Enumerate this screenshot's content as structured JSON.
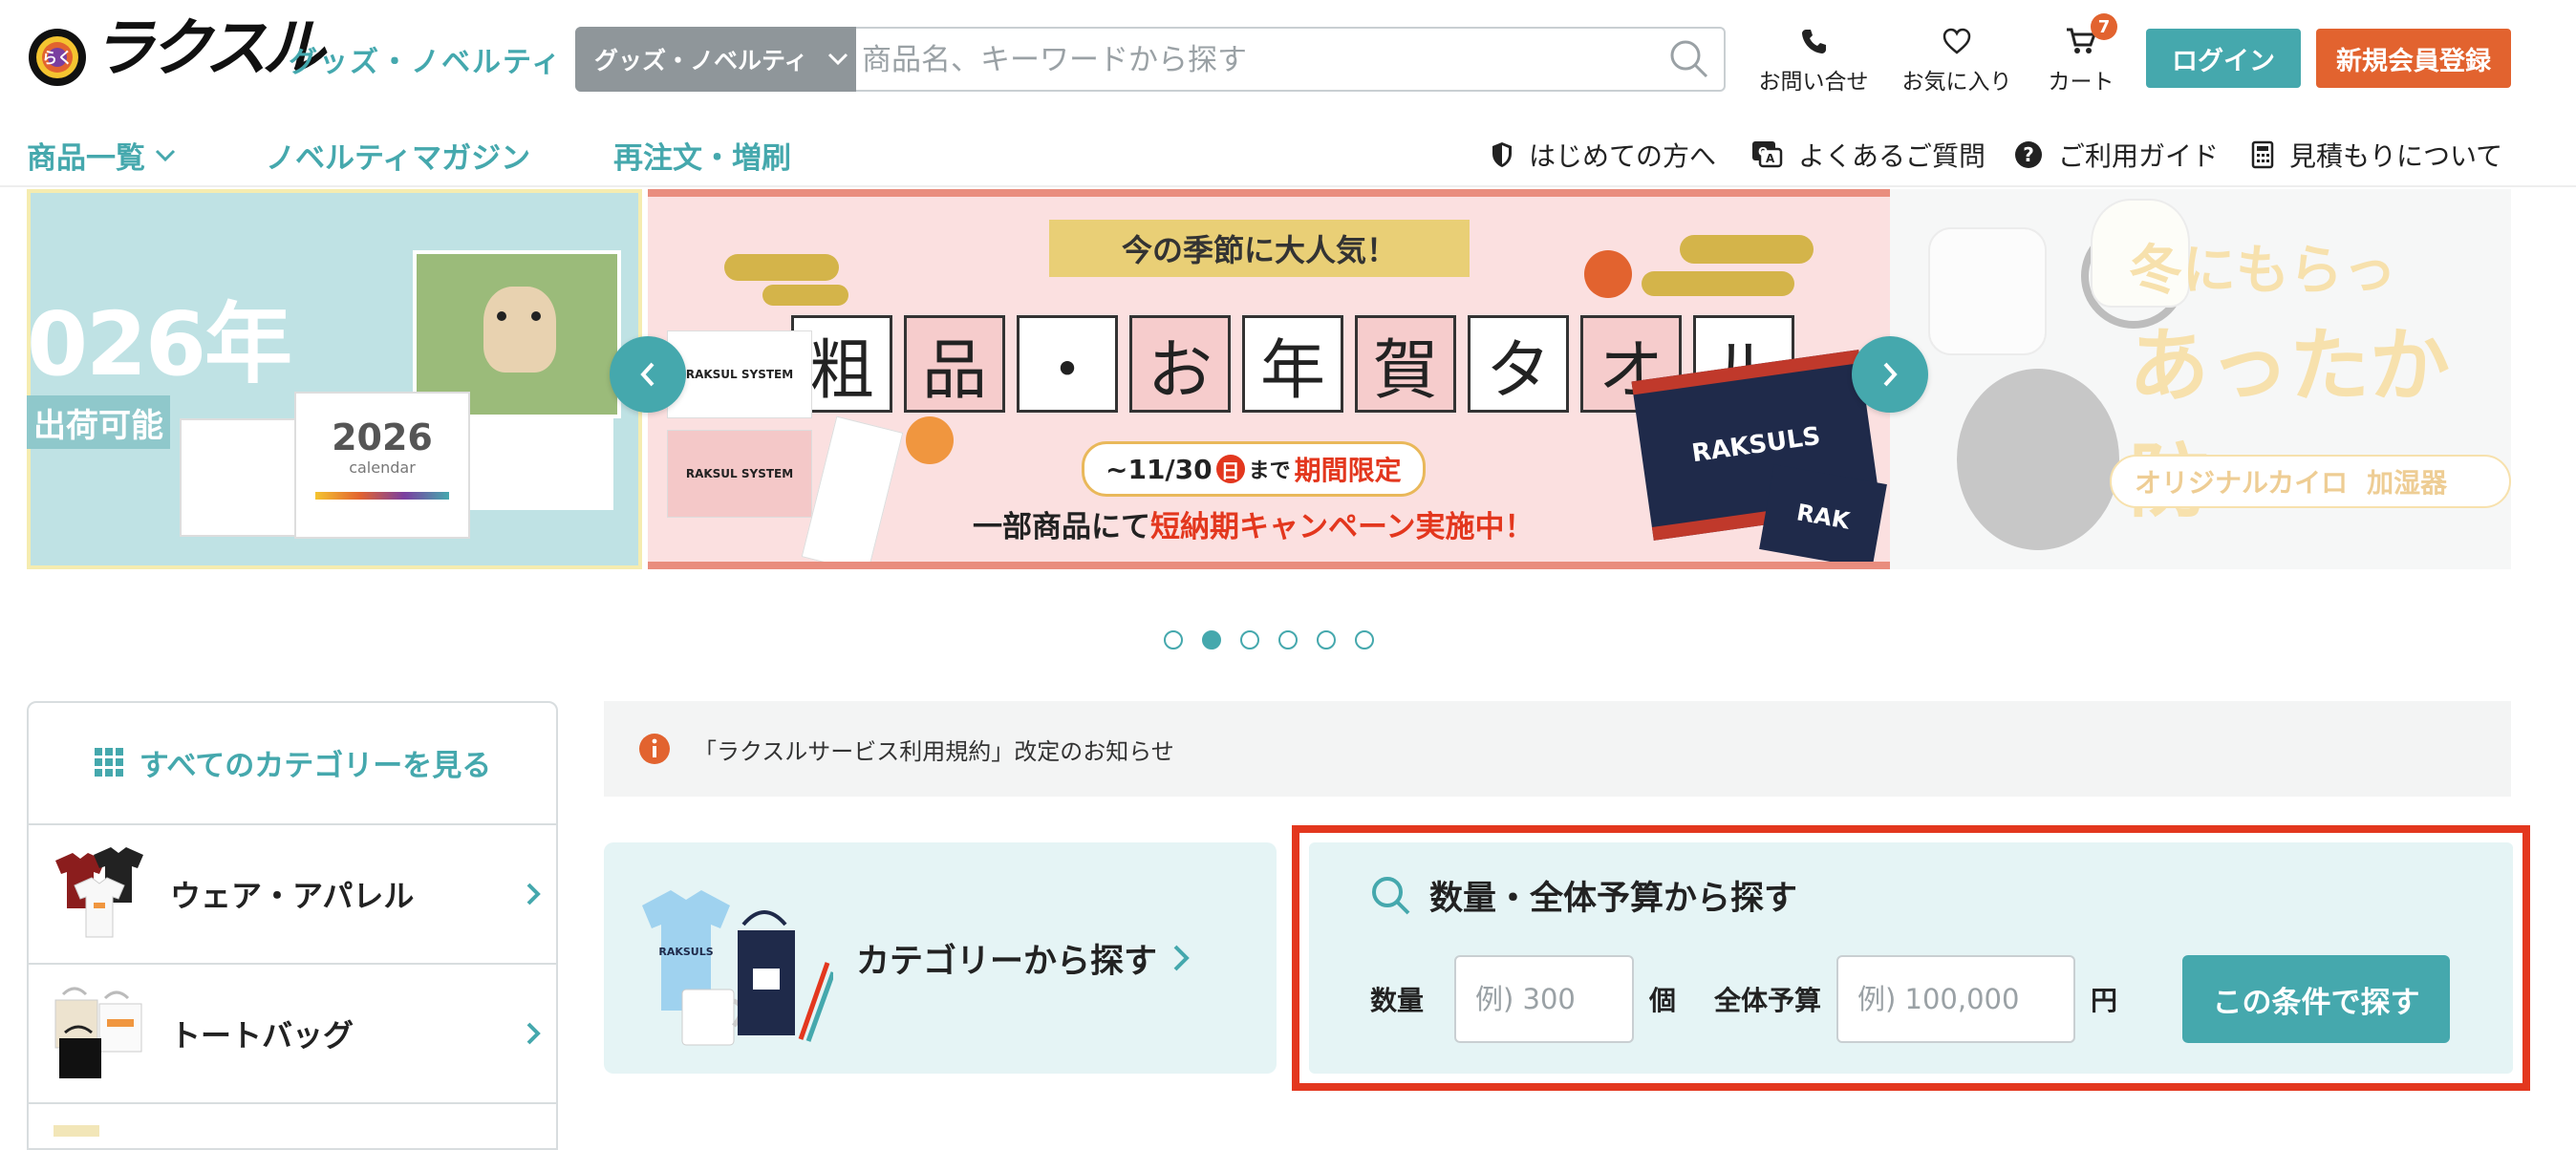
{
  "header": {
    "logo_text": "ラクスル",
    "logo_sub": "グッズ・ノベルティ",
    "search": {
      "category": "グッズ・ノベルティ",
      "placeholder": "商品名、キーワードから探す"
    },
    "icons": {
      "contact_label": "お問い合せ",
      "favorites_label": "お気に入り",
      "cart_label": "カート",
      "cart_count": "7"
    },
    "login_label": "ログイン",
    "signup_label": "新規会員登録"
  },
  "nav": {
    "items": [
      {
        "label": "商品一覧"
      },
      {
        "label": "ノベルティマガジン"
      },
      {
        "label": "再注文・増刷"
      }
    ],
    "utility": [
      {
        "label": "はじめての方へ",
        "icon": "shield-icon"
      },
      {
        "label": "よくあるご質問",
        "icon": "qa-icon"
      },
      {
        "label": "ご利用ガイド",
        "icon": "question-icon"
      },
      {
        "label": "見積もりについて",
        "icon": "calculator-icon"
      }
    ]
  },
  "carousel": {
    "left_slide": {
      "year_text": "026年",
      "ship_text": "出荷可能",
      "calendar_year": "2026",
      "calendar_word": "calendar"
    },
    "main_slide": {
      "badge": "今の季節に大人気！",
      "title_chars": [
        "粗",
        "品",
        "・",
        "お",
        "年",
        "賀",
        "タ",
        "オ",
        "ル"
      ],
      "period_prefix": "~11/30",
      "period_day": "日",
      "period_mid": "まで",
      "period_suffix": "期間限定",
      "campaign_prefix": "一部商品にて",
      "campaign_highlight": "短納期キャンペーン実施中！",
      "brand_1": "RAKSUL SYSTEM",
      "brand_2": "RAKSULS",
      "brand_3": "RAK"
    },
    "right_slide": {
      "line1": "冬にもらっ",
      "line2": "あったか防",
      "line3": "オリジナルカイロ",
      "line4": "加湿器"
    },
    "dot_count": 6,
    "active_dot": 1
  },
  "sidebar": {
    "all_label": "すべてのカテゴリーを見る",
    "items": [
      {
        "label": "ウェア・アパレル"
      },
      {
        "label": "トートバッグ"
      }
    ]
  },
  "notice": {
    "text": "「ラクスルサービス利用規約」改定のお知らせ"
  },
  "category_search": {
    "label": "カテゴリーから探す",
    "brand": "RAKSULS"
  },
  "qty_search": {
    "title": "数量・全体予算から探す",
    "qty_label": "数量",
    "qty_placeholder": "例) 300",
    "qty_unit": "個",
    "budget_label": "全体予算",
    "budget_placeholder": "例) 100,000",
    "budget_unit": "円",
    "button_label": "この条件で探す"
  },
  "colors": {
    "teal": "#45a8ad",
    "orange": "#e2632f",
    "highlight_red": "#e3371e"
  }
}
